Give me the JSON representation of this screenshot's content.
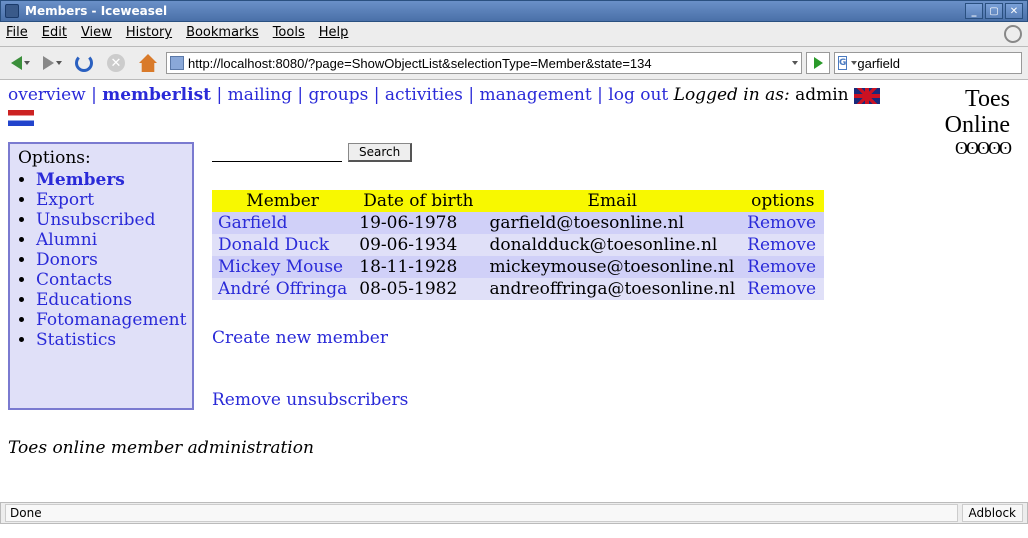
{
  "window": {
    "title": "Members - Iceweasel"
  },
  "menubar": [
    "File",
    "Edit",
    "View",
    "History",
    "Bookmarks",
    "Tools",
    "Help"
  ],
  "toolbar": {
    "url": "http://localhost:8080/?page=ShowObjectList&selectionType=Member&state=134",
    "search_engine_glyph": "G",
    "search_value": "garfield"
  },
  "topnav": {
    "items": [
      "overview",
      "memberlist",
      "mailing",
      "groups",
      "activities",
      "management",
      "log out"
    ],
    "active_index": 1,
    "logged_label": "Logged in as:",
    "user": "admin"
  },
  "logo": {
    "line1": "Toes",
    "line2": "Online"
  },
  "sidebar": {
    "header": "Options:",
    "items": [
      "Members",
      "Export",
      "Unsubscribed",
      "Alumni",
      "Donors",
      "Contacts",
      "Educations",
      "Fotomanagement",
      "Statistics"
    ],
    "active_index": 0
  },
  "search_panel": {
    "button": "Search",
    "value": ""
  },
  "table": {
    "columns": [
      "Member",
      "Date of birth",
      "Email",
      "options"
    ],
    "rows": [
      {
        "member": "Garfield",
        "dob": "19-06-1978",
        "email": "garfield@toesonline.nl",
        "opt": "Remove"
      },
      {
        "member": "Donald Duck",
        "dob": "09-06-1934",
        "email": "donaldduck@toesonline.nl",
        "opt": "Remove"
      },
      {
        "member": "Mickey Mouse",
        "dob": "18-11-1928",
        "email": "mickeymouse@toesonline.nl",
        "opt": "Remove"
      },
      {
        "member": "André Offringa",
        "dob": "08-05-1982",
        "email": "andreoffringa@toesonline.nl",
        "opt": "Remove"
      }
    ]
  },
  "links": {
    "create": "Create new member",
    "remove_unsub": "Remove unsubscribers"
  },
  "footer": "Toes online member administration",
  "statusbar": {
    "status": "Done",
    "adblock": "Adblock"
  }
}
